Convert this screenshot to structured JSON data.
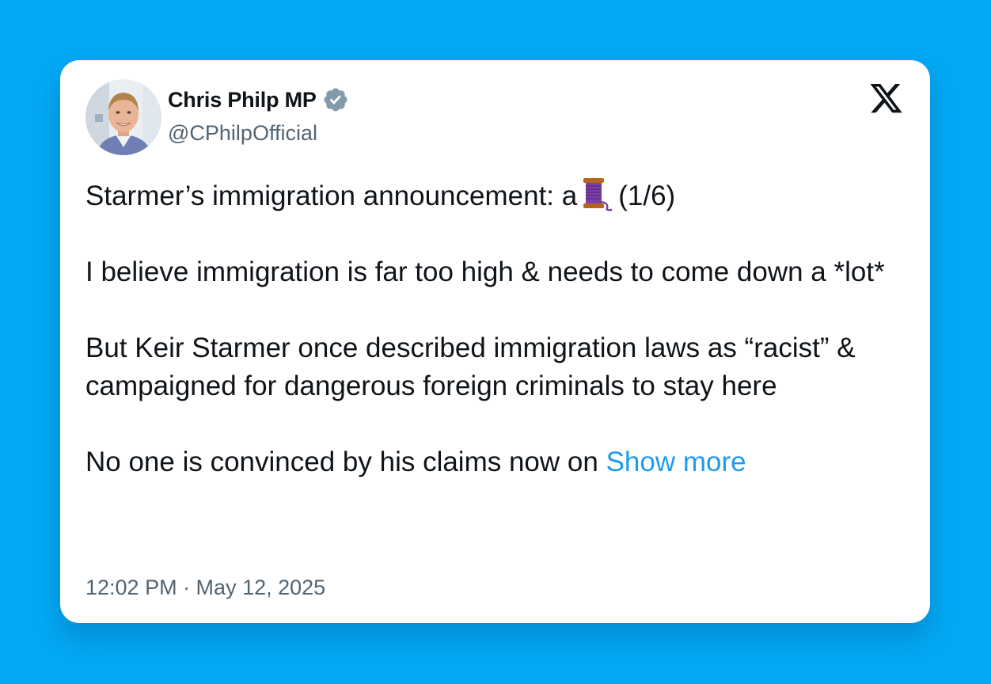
{
  "post": {
    "author": {
      "display_name": "Chris Philp MP",
      "handle": "@CPhilpOfficial",
      "verified_icon": "verified-badge-icon",
      "avatar_icon": "profile-photo"
    },
    "platform_icon": "x-logo-icon",
    "paragraphs": [
      {
        "before_emoji": "Starmer’s immigration announcement: a",
        "emoji": "spool-of-thread-emoji",
        "after_emoji": "(1/6)"
      },
      {
        "text": "I believe immigration is far too high & needs to come down a *lot*"
      },
      {
        "text": "But Keir Starmer once described immigration laws as “racist” & campaigned for dangerous foreign criminals to stay here"
      },
      {
        "text": "No one is convinced by his claims now on",
        "show_more_label": "Show more"
      }
    ],
    "timestamp": "12:02 PM · May 12, 2025"
  },
  "colors": {
    "background": "#03a9f4",
    "card": "#ffffff",
    "text_primary": "#0f1419",
    "text_secondary": "#536471",
    "link": "#1d9bf0",
    "verified_badge": "#829aab"
  }
}
